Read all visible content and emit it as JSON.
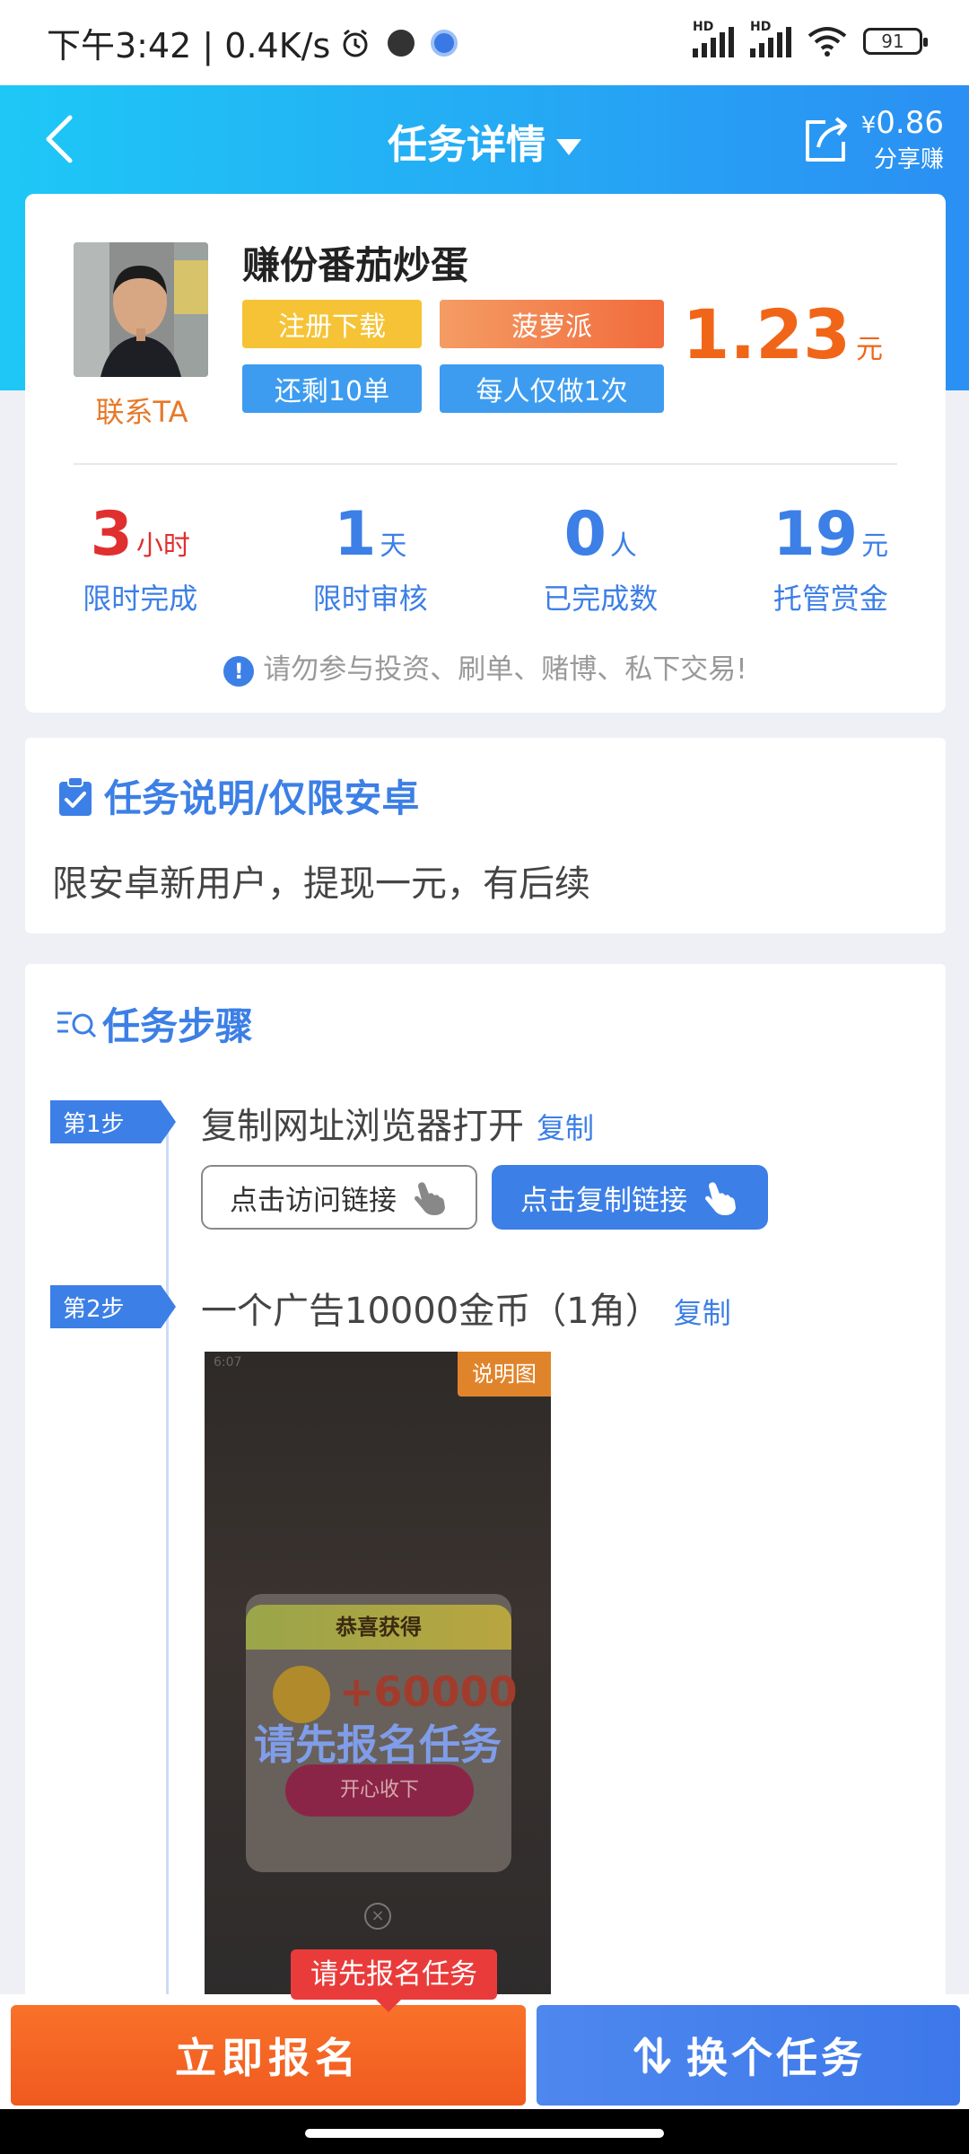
{
  "status_bar": {
    "time": "下午3:42 | 0.4K/s",
    "hd": "HD",
    "battery": "91"
  },
  "header": {
    "title": "任务详情",
    "share_currency": "¥",
    "share_amount": "0.86",
    "share_label": "分享赚"
  },
  "task": {
    "contact_label": "联系TA",
    "title": "赚份番茄炒蛋",
    "tags": [
      "注册下载",
      "菠萝派",
      "还剩10单",
      "每人仅做1次"
    ],
    "price": "1.23",
    "price_unit": "元",
    "stats": [
      {
        "num": "3",
        "unit": "小时",
        "label": "限时完成"
      },
      {
        "num": "1",
        "unit": "天",
        "label": "限时审核"
      },
      {
        "num": "0",
        "unit": "人",
        "label": "已完成数"
      },
      {
        "num": "19",
        "unit": "元",
        "label": "托管赏金"
      }
    ],
    "warning": "请勿参与投资、刷单、赌博、私下交易!"
  },
  "description": {
    "title": "任务说明/仅限安卓",
    "text": "限安卓新用户，提现一元，有后续"
  },
  "steps": {
    "title": "任务步骤",
    "copy_label": "复制",
    "step1": {
      "badge": "第1步",
      "text": "复制网址浏览器打开",
      "visit_button": "点击访问链接",
      "copy_button": "点击复制链接"
    },
    "step2": {
      "badge": "第2步",
      "text": "一个广告10000金币（1角）",
      "screenshot_tag": "说明图",
      "overlay": "请先报名任务",
      "popup_head": "恭喜获得",
      "popup_amount": "+60000",
      "popup_button": "开心收下",
      "shot_time": "6:07"
    }
  },
  "bottom": {
    "tooltip": "请先报名任务",
    "signup": "立即报名",
    "switch": "换个任务"
  },
  "colors": {
    "brand_blue": "#3c7fe6",
    "orange": "#f06518",
    "header_gradient_start": "#1ec8f6",
    "header_gradient_end": "#2b8ff3"
  }
}
